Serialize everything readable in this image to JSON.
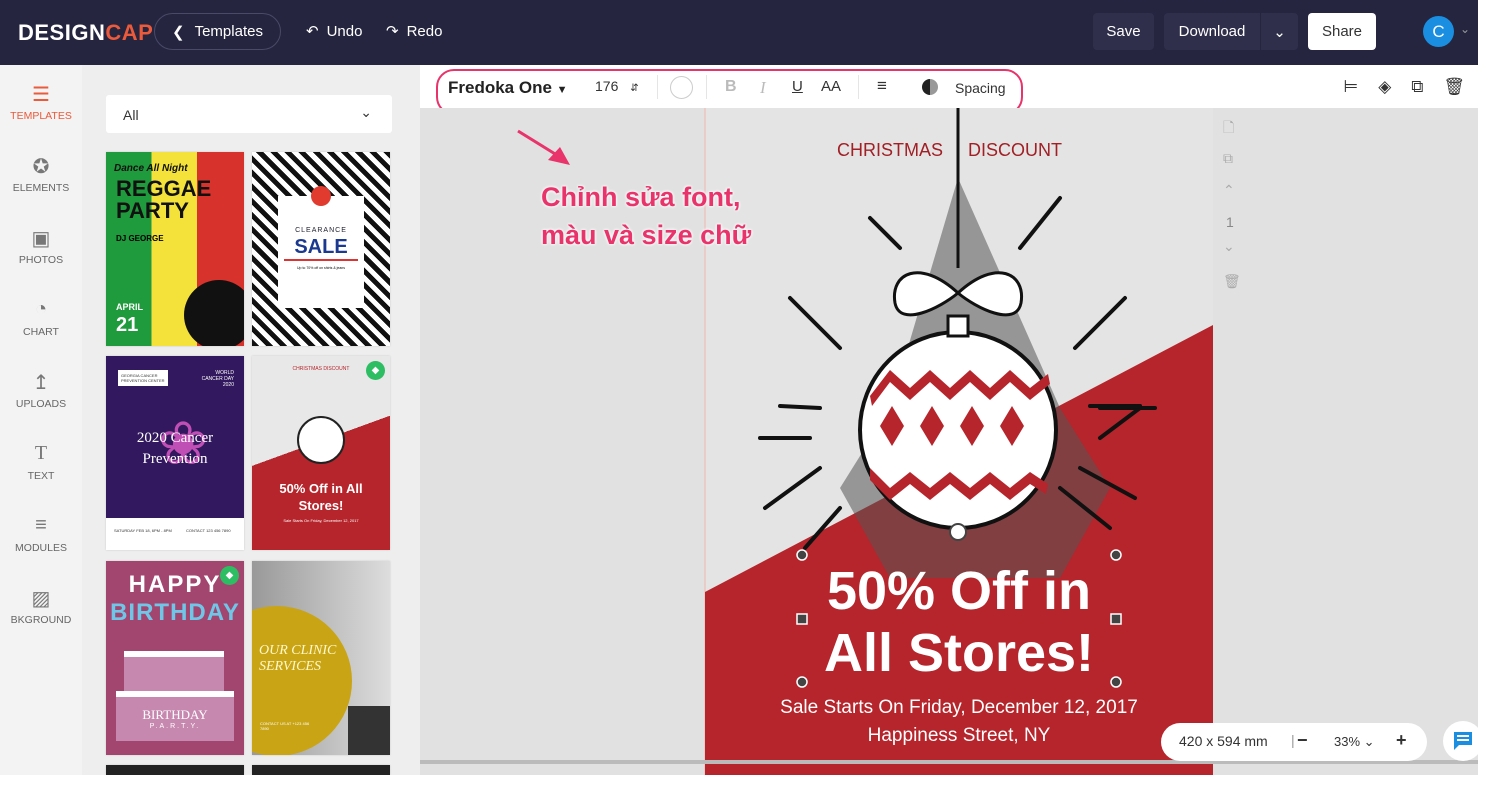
{
  "header": {
    "logo_a": "DESIGN",
    "logo_b": "CAP",
    "templates_label": "Templates",
    "undo": "Undo",
    "redo": "Redo",
    "save": "Save",
    "download": "Download",
    "share": "Share",
    "avatar_initial": "C"
  },
  "sidebar": {
    "items": [
      {
        "label": "TEMPLATES",
        "icon": "layers-icon"
      },
      {
        "label": "ELEMENTS",
        "icon": "star-badge-icon"
      },
      {
        "label": "PHOTOS",
        "icon": "image-icon"
      },
      {
        "label": "CHART",
        "icon": "pie-chart-icon"
      },
      {
        "label": "UPLOADS",
        "icon": "upload-icon"
      },
      {
        "label": "TEXT",
        "icon": "text-icon"
      },
      {
        "label": "MODULES",
        "icon": "list-icon"
      },
      {
        "label": "BKGROUND",
        "icon": "background-icon"
      }
    ]
  },
  "panel": {
    "filter": "All",
    "templates": [
      {
        "t1": "Dance All Night",
        "t2": "REGGAE PARTY",
        "t3": "DJ GEORGE",
        "t4": "APRIL",
        "t5": "21"
      },
      {
        "t1": "CLEARANCE",
        "t2": "SALE",
        "t3": "Up to 70% off on shirts & jeans"
      },
      {
        "t1": "GEORGIA CANCER PREVENTION CENTER",
        "t2": "WORLD CANCER DAY 2020",
        "t3": "2020 Cancer Prevention",
        "t4": "SATURDAY FEB 18, 6PM - 8PM",
        "t5": "CONTACT 123 456 7890"
      },
      {
        "t1": "CHRISTMAS   DISCOUNT",
        "t2": "50% Off in All Stores!",
        "t3": "Sale Starts On Friday, December 12, 2017"
      },
      {
        "t1": "HAPPY",
        "t2": "BIRTHDAY",
        "t3": "BIRTHDAY",
        "t4": "P.A.R.T.Y."
      },
      {
        "t1": "OUR CLINIC SERVICES",
        "t2": "CONTACT US AT +123 456 7890"
      }
    ]
  },
  "toolbar": {
    "font": "Fredoka One",
    "size": "176",
    "bold": "B",
    "italic": "I",
    "underline": "U",
    "case": "AA",
    "spacing": "Spacing"
  },
  "annotation": {
    "line1": "Chỉnh sửa font,",
    "line2": "màu và size chữ",
    "color": "#e8336b"
  },
  "poster": {
    "top_left": "CHRISTMAS",
    "top_right": "DISCOUNT",
    "headline1": "50% Off in",
    "headline2": "All Stores!",
    "sub1": "Sale Starts On Friday, December 12, 2017",
    "sub2": "Happiness Street, NY",
    "red": "#b5252b"
  },
  "page_controls": {
    "page": "1"
  },
  "zoom": {
    "dimensions": "420 x 594 mm",
    "level": "33%",
    "minus": "−",
    "plus": "+"
  }
}
